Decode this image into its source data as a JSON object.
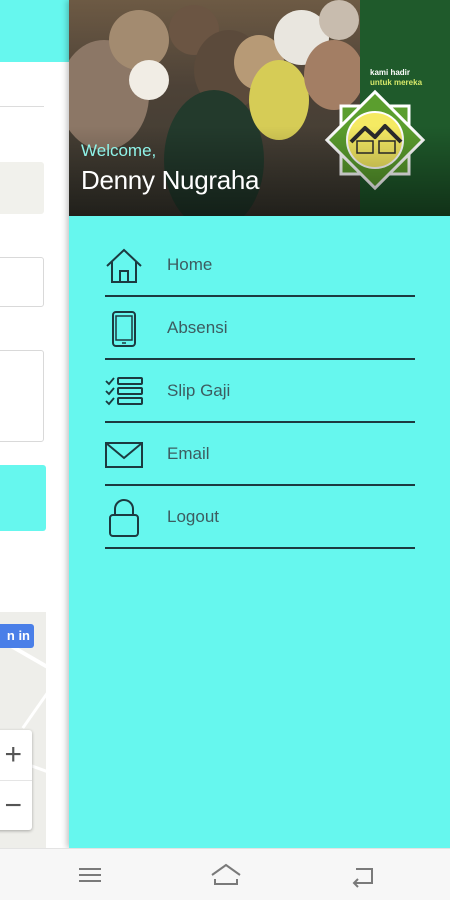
{
  "background": {
    "signin_label": "n in",
    "zoom_in_label": "+",
    "zoom_out_label": "−"
  },
  "drawer": {
    "header": {
      "welcome": "Welcome,",
      "user_name": "Denny Nugraha",
      "banner_line1": "kami hadir",
      "banner_line2": "untuk mereka"
    },
    "menu": [
      {
        "label": "Home",
        "icon": "home-icon"
      },
      {
        "label": "Absensi",
        "icon": "phone-icon"
      },
      {
        "label": "Slip Gaji",
        "icon": "checklist-icon"
      },
      {
        "label": "Email",
        "icon": "envelope-icon"
      },
      {
        "label": "Logout",
        "icon": "lock-icon"
      }
    ]
  },
  "navbar": {
    "buttons": [
      "menu-icon",
      "home-icon",
      "back-icon"
    ]
  },
  "colors": {
    "accent": "#66f7ee",
    "menu_text": "#3d5c60",
    "divider": "#1c3a40"
  }
}
